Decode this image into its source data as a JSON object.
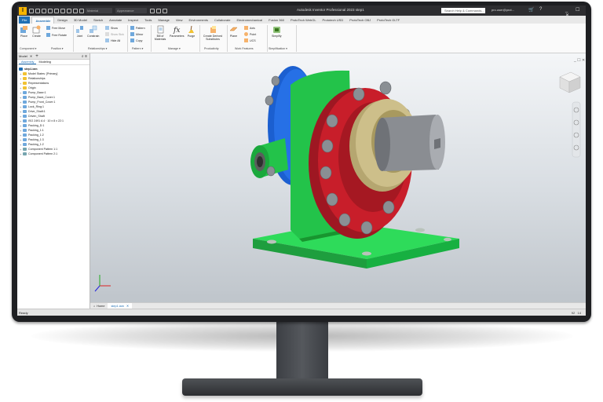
{
  "titlebar": {
    "logo": "I",
    "material": "Material",
    "appearance": "Appearance",
    "title": "Autodesk Inventor Professional 2023  step1",
    "search_placeholder": "Search Help & Commands...",
    "user": "pro.user@prot...",
    "help": "?",
    "window_buttons": "_ ☐ ✕"
  },
  "tabs": [
    "File",
    "Assemble",
    "Design",
    "3D Model",
    "Sketch",
    "Annotate",
    "Inspect",
    "Tools",
    "Manage",
    "View",
    "Environments",
    "Collaborate",
    "Electromechanical",
    "Fusion 360",
    "ProtoTech WebGL",
    "Prototech USD",
    "ProtoTech OBJ",
    "ProtoTech GLTF"
  ],
  "active_tab": "Assemble",
  "ribbon": {
    "place": "Place",
    "create": "Create",
    "free_move": "Free Move",
    "free_rotate": "Free Rotate",
    "joint": "Joint",
    "constrain": "Constrain",
    "show": "Show",
    "show_sick": "Show Sick",
    "hide_all": "Hide All",
    "pattern": "Pattern",
    "mirror": "Mirror",
    "copy": "Copy",
    "bill_of_materials": "Bill of Materials",
    "parameters": "Parameters",
    "purge": "Purge",
    "create_derived": "Create Derived Substitutes",
    "plane": "Plane",
    "axis": "Axis",
    "point": "Point",
    "ucs": "UCS",
    "simplify": "Simplify",
    "groups": {
      "component": "Component ▾",
      "position": "Position ▾",
      "relationships": "Relationships ▾",
      "pattern": "Pattern ▾",
      "manage": "Manage ▾",
      "productivity": "Productivity",
      "work_features": "Work Features",
      "simplification": "Simplification ▾"
    }
  },
  "panel": {
    "title": "Model",
    "close": "✕",
    "add": "+",
    "tabs": [
      "Assembly",
      "Modeling"
    ],
    "tree": [
      {
        "label": "step1.iam",
        "kind": "root"
      },
      {
        "label": "Model States: [Primary]",
        "kind": "folder"
      },
      {
        "label": "Relationships",
        "kind": "folder"
      },
      {
        "label": "Representations",
        "kind": "folder"
      },
      {
        "label": "Origin",
        "kind": "folder"
      },
      {
        "label": "Pump_Base:1",
        "kind": "part"
      },
      {
        "label": "Pump_Back_Cover:1",
        "kind": "part"
      },
      {
        "label": "Pump_Front_Cover:1",
        "kind": "part"
      },
      {
        "label": "Lock_Ring:1",
        "kind": "part"
      },
      {
        "label": "Drive_Shaft:1",
        "kind": "part"
      },
      {
        "label": "Driven_Shaft",
        "kind": "part"
      },
      {
        "label": "ISO 2491 A 4 · 10 x 8 x 22:1",
        "kind": "part"
      },
      {
        "label": "Packing_D:1",
        "kind": "part"
      },
      {
        "label": "Packing_1:1",
        "kind": "part"
      },
      {
        "label": "Packing_1:2",
        "kind": "part"
      },
      {
        "label": "Packing_1:3",
        "kind": "part"
      },
      {
        "label": "Packing_1:2",
        "kind": "part"
      },
      {
        "label": "Component Pattern 1:1",
        "kind": "pattern"
      },
      {
        "label": "Component Pattern 2:1",
        "kind": "pattern"
      }
    ]
  },
  "doc_tabs": {
    "home": "Home",
    "active": "step1.iam",
    "close": "✕"
  },
  "status": {
    "left": "Ready",
    "right_a": "92",
    "right_b": "14"
  },
  "colors": {
    "accent": "#1f6fb5",
    "base_green": "#23c34a",
    "cover_red": "#c81e2a",
    "cover_blue": "#1b5fd0",
    "ring_tan": "#cdbf8a",
    "shaft_gray": "#8a8d92"
  }
}
